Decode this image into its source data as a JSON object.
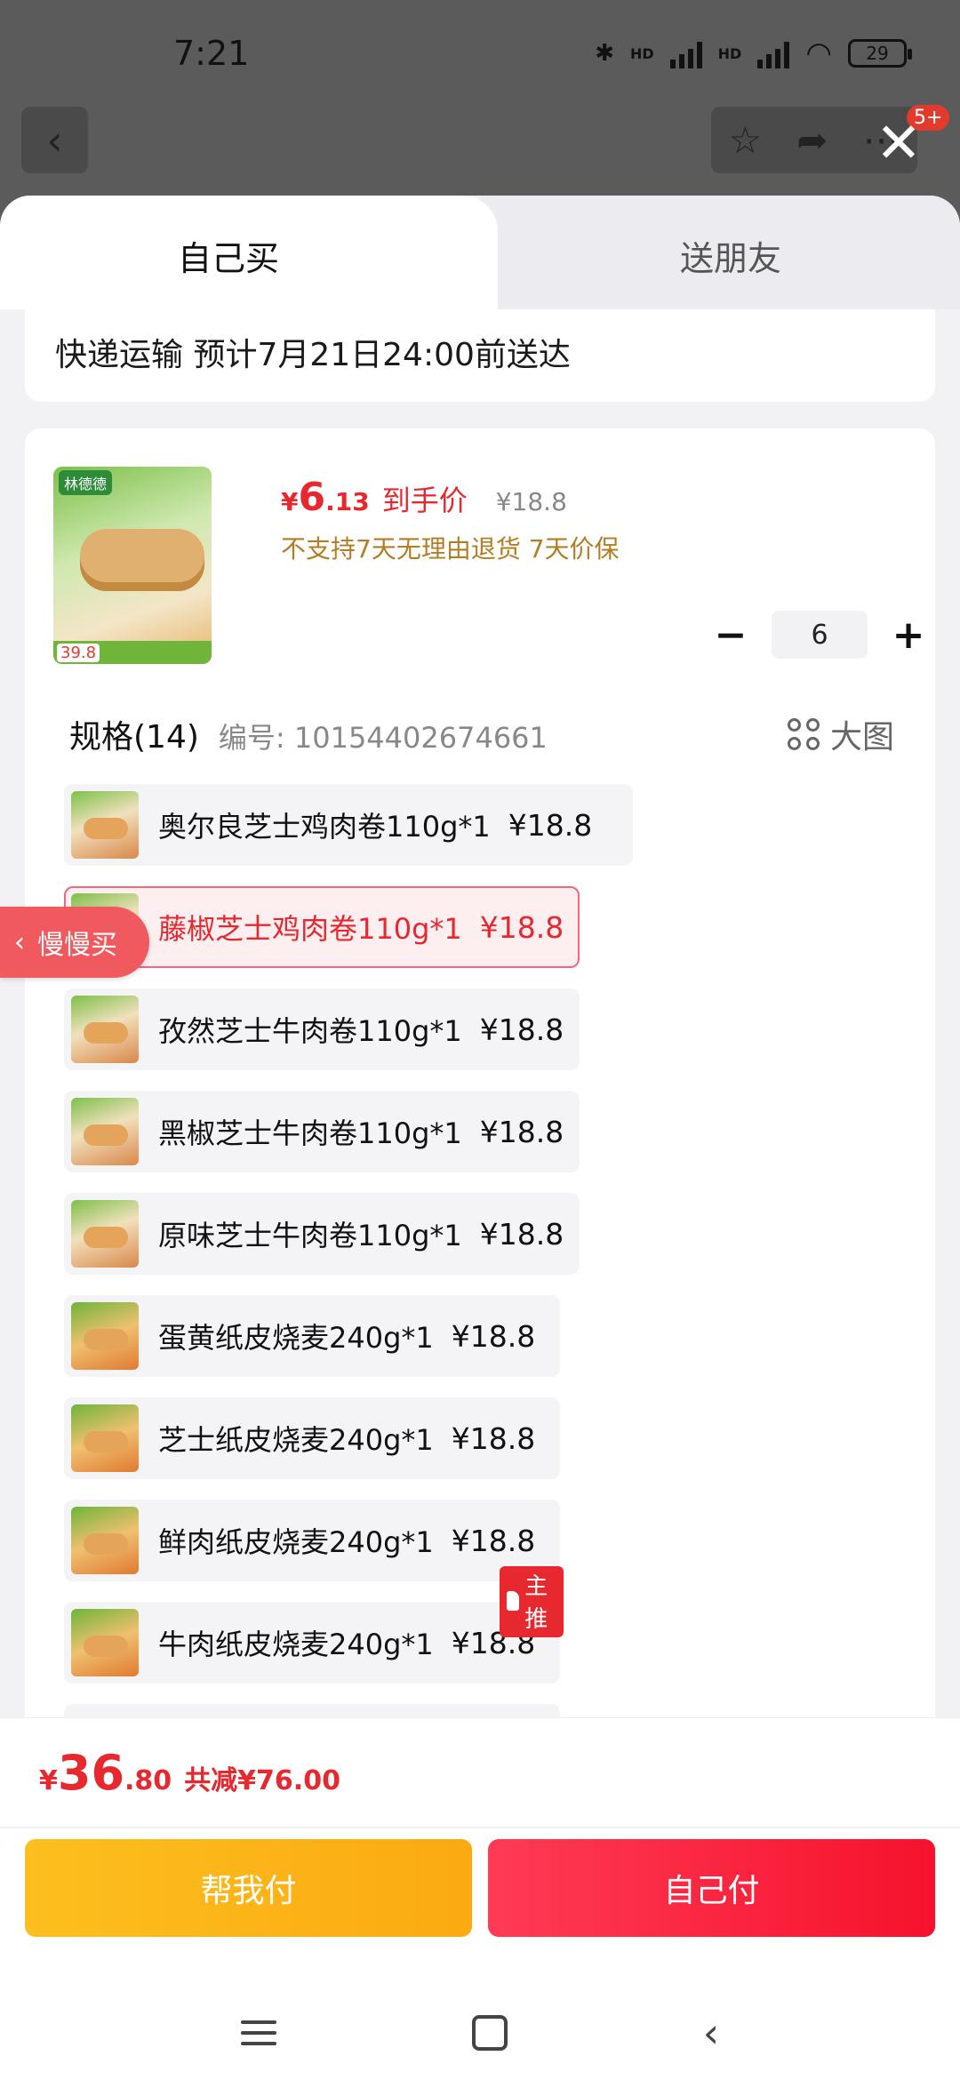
{
  "status_bar": {
    "time": "7:21",
    "battery": "29",
    "network": [
      "HD",
      "HD"
    ]
  },
  "top_bar": {
    "badge": "5+"
  },
  "tabs": {
    "self_buy": "自己买",
    "gift_friend": "送朋友"
  },
  "shipping": {
    "text": "快递运输 预计7月21日24:00前送达"
  },
  "product": {
    "price_currency": "¥",
    "price_integer": "6",
    "price_decimal": ".13",
    "price_label": "到手价",
    "original_price": "¥18.8",
    "policy": "不支持7天无理由退货 7天价保",
    "quantity": "6",
    "thumb_logo": "林德德",
    "thumb_price": "39.8"
  },
  "spec": {
    "title": "规格(14)",
    "sku": "编号: 10154402674661",
    "big_picture": "大图"
  },
  "options": [
    {
      "name": "奥尔良芝士鸡肉卷110g*1",
      "price": "¥18.8",
      "selected": false
    },
    {
      "name": "藤椒芝士鸡肉卷110g*1",
      "price": "¥18.8",
      "selected": true
    },
    {
      "name": "孜然芝士牛肉卷110g*1",
      "price": "¥18.8",
      "selected": false
    },
    {
      "name": "黑椒芝士牛肉卷110g*1",
      "price": "¥18.8",
      "selected": false
    },
    {
      "name": "原味芝士牛肉卷110g*1",
      "price": "¥18.8",
      "selected": false
    },
    {
      "name": "蛋黄纸皮烧麦240g*1",
      "price": "¥18.8",
      "selected": false
    },
    {
      "name": "芝士纸皮烧麦240g*1",
      "price": "¥18.8",
      "selected": false
    },
    {
      "name": "鲜肉纸皮烧麦240g*1",
      "price": "¥18.8",
      "selected": false
    },
    {
      "name": "牛肉纸皮烧麦240g*1",
      "price": "¥18.8",
      "selected": false
    }
  ],
  "featured_badge": "主推",
  "slow_buy": "慢慢买",
  "footer": {
    "total_currency": "¥",
    "total_integer": "36",
    "total_decimal": ".80",
    "total_saving": "共减¥76.00",
    "help_pay": "帮我付",
    "self_pay": "自己付"
  },
  "colors": {
    "accent_red": "#e8282f",
    "help_yellow": "#fcbf1e",
    "policy_brown": "#b37d24"
  }
}
